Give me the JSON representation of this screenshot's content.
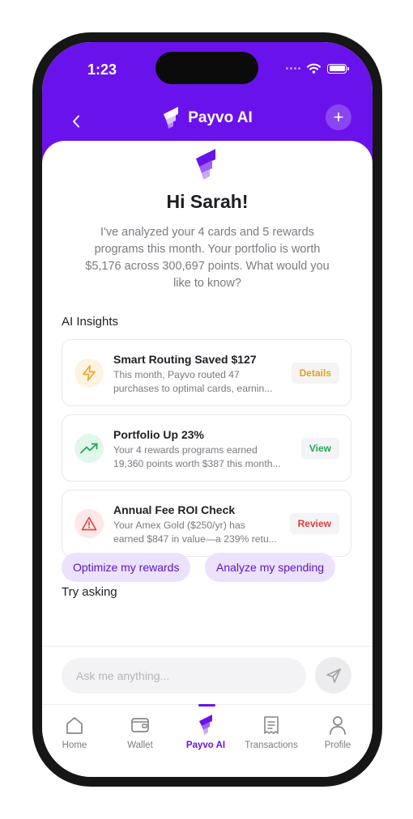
{
  "status_bar": {
    "time": "1:23"
  },
  "header": {
    "title": "Payvo AI"
  },
  "hero": {
    "greeting": "Hi Sarah!",
    "intro": "I've analyzed your 4 cards and 5 rewards programs this month. Your portfolio is worth $5,176 across 300,697 points. What would you like to know?"
  },
  "insights": {
    "section_title": "AI Insights",
    "items": [
      {
        "title": "Smart Routing Saved $127",
        "desc_line1": "This month, Payvo routed 47",
        "desc_line2": "purchases to optimal cards, earnin...",
        "action": "Details",
        "icon": "lightning-icon",
        "icon_bg": "#fdf3e1",
        "icon_color": "#eea62c",
        "action_bg": "#f4f4f6",
        "action_color": "#e3a121"
      },
      {
        "title": "Portfolio Up 23%",
        "desc_line1": "Your 4 rewards programs earned",
        "desc_line2": "19,360 points worth $387 this month...",
        "action": "View",
        "icon": "trending-up-icon",
        "icon_bg": "#e2f6e9",
        "icon_color": "#22a755",
        "action_bg": "#f4f4f6",
        "action_color": "#22a755"
      },
      {
        "title": "Annual Fee ROI Check",
        "desc_line1": "Your Amex Gold ($250/yr) has",
        "desc_line2": "earned $847 in value—a 239% retu...",
        "action": "Review",
        "icon": "warning-icon",
        "icon_bg": "#fde7e7",
        "icon_color": "#e14a4a",
        "action_bg": "#f4f4f6",
        "action_color": "#e03b3b"
      }
    ]
  },
  "suggestions": {
    "section_title": "Try asking",
    "chips": [
      "Optimize my rewards",
      "Analyze my spending"
    ]
  },
  "input": {
    "placeholder": "Ask me anything..."
  },
  "tabs": [
    {
      "label": "Home",
      "icon": "home-icon"
    },
    {
      "label": "Wallet",
      "icon": "wallet-icon"
    },
    {
      "label": "Payvo AI",
      "icon": "payvo-logo-icon",
      "active": true
    },
    {
      "label": "Transactions",
      "icon": "receipt-icon"
    },
    {
      "label": "Profile",
      "icon": "profile-icon"
    }
  ],
  "colors": {
    "brand": "#6a12ec",
    "chip_bg": "#ebe2fd",
    "chip_text": "#5b13c9"
  }
}
